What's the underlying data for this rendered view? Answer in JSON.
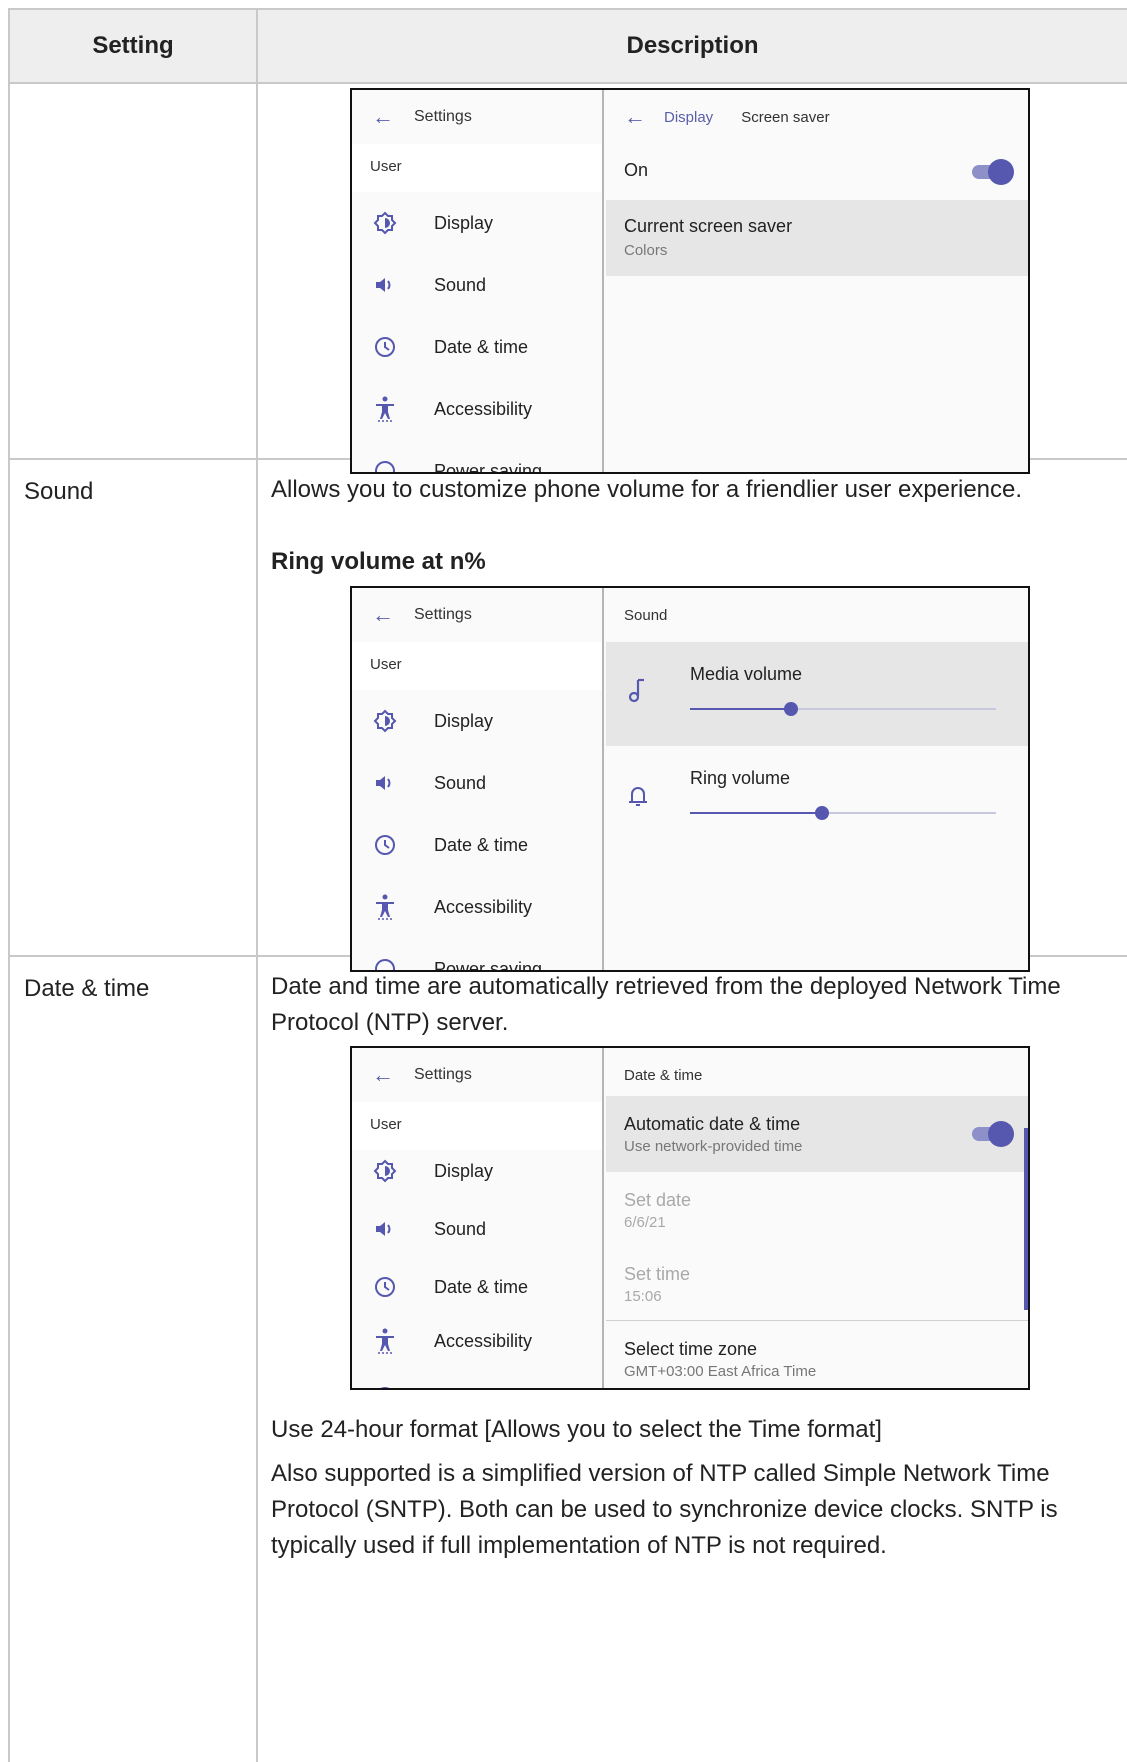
{
  "table": {
    "header": {
      "setting": "Setting",
      "description": "Description"
    }
  },
  "settings_nav": {
    "title": "Settings",
    "section": "User",
    "items": [
      {
        "label": "Display",
        "icon": "brightness-icon"
      },
      {
        "label": "Sound",
        "icon": "volume-icon"
      },
      {
        "label": "Date & time",
        "icon": "clock-icon"
      },
      {
        "label": "Accessibility",
        "icon": "accessibility-icon"
      },
      {
        "label": "Power saving",
        "icon": "power-icon"
      }
    ]
  },
  "rows": [
    {
      "setting": "",
      "screenshot": {
        "breadcrumb": "Display",
        "title": "Screen saver",
        "on_label": "On",
        "toggle_on": true,
        "item_title": "Current screen saver",
        "item_sub": "Colors"
      }
    },
    {
      "setting": "Sound",
      "description": "Allows you to customize phone volume for a friendlier user experience.",
      "bold": "Ring volume at n%",
      "screenshot": {
        "title": "Sound",
        "media_label": "Media volume",
        "media_level": 0.33,
        "ring_label": "Ring volume",
        "ring_level": 0.43
      }
    },
    {
      "setting": "Date & time",
      "description": "Date and time are automatically retrieved from the deployed Network Time Protocol (NTP) server.",
      "screenshot": {
        "title": "Date & time",
        "auto_title": "Automatic date & time",
        "auto_sub": "Use network-provided time",
        "auto_on": true,
        "date_title": "Set date",
        "date_value": "6/6/21",
        "time_title": "Set time",
        "time_value": "15:06",
        "zone_title": "Select time zone",
        "zone_value": "GMT+03:00 East Africa Time"
      },
      "after_1": "Use 24-hour format [Allows you to select the Time format]",
      "after_2": "Also supported is a simplified version of NTP called Simple Network Time Protocol (SNTP). Both can be used to synchronize device clocks. SNTP is typically used if full implementation of NTP is not required."
    }
  ],
  "colors": {
    "accent": "#5558ae",
    "selected_row": "#e6e6e6",
    "header_bg": "#eeeeee"
  }
}
